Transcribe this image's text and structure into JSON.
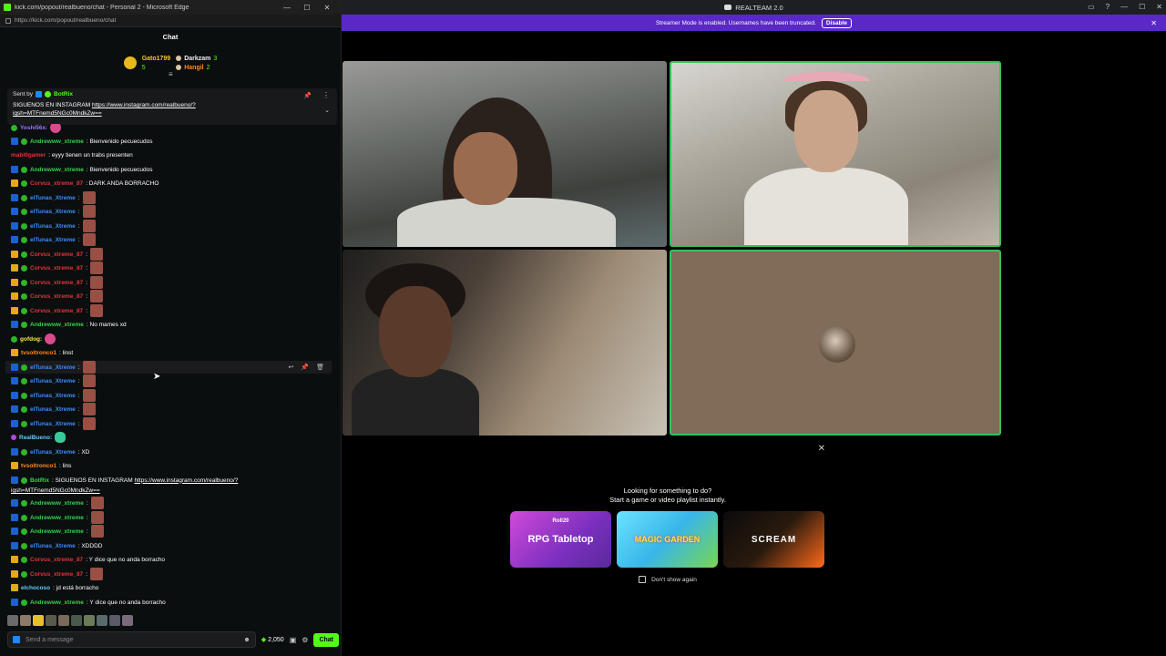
{
  "browser": {
    "title": "kick.com/popout/realbueno/chat - Personal 2 - Microsoft Edge",
    "url": "https://kick.com/popout/realbueno/chat",
    "min": "—",
    "max": "☐",
    "close": "✕"
  },
  "chat": {
    "header": "Chat",
    "leaders": [
      {
        "name": "Gato1799",
        "count": "5"
      },
      {
        "name": "Darkzam",
        "count": "3"
      },
      {
        "name": "Hangil",
        "count": "2"
      }
    ],
    "pinned": {
      "sent_by": "Sent by",
      "bot": "BotRix",
      "text": "SIGUENOS EN INSTAGRAM",
      "link1": "https://www.instagram.com/realbueno/?",
      "link2": "igsh=MTFnemd5NGc0MndkZw=="
    },
    "messages": [
      {
        "user": "Yoshi56x:",
        "text": ""
      },
      {
        "user": "Andrewww_xtreme",
        "text": ": Bienvenido pecuecudos"
      },
      {
        "user": "mabi0gamer",
        "text": ": eyyy tienen un trabs presenten"
      },
      {
        "user": "Andrewww_xtreme",
        "text": ": Bienvenido pecuecudos"
      },
      {
        "user": "Corvus_xtreme_87",
        "text": ": DARK ANDA BORRACHO"
      },
      {
        "user": "elTunas_Xtreme",
        "text": ":"
      },
      {
        "user": "elTunas_Xtreme",
        "text": ":"
      },
      {
        "user": "elTunas_Xtreme",
        "text": ":"
      },
      {
        "user": "elTunas_Xtreme",
        "text": ":"
      },
      {
        "user": "Corvus_xtreme_87",
        "text": ":"
      },
      {
        "user": "Corvus_xtreme_87",
        "text": ":"
      },
      {
        "user": "Corvus_xtreme_87",
        "text": ":"
      },
      {
        "user": "Corvus_xtreme_87",
        "text": ":"
      },
      {
        "user": "Corvus_xtreme_87",
        "text": ":"
      },
      {
        "user": "Andrewww_xtreme",
        "text": ": No mames xd"
      },
      {
        "user": "gofdog:",
        "text": ""
      },
      {
        "user": "tvsoltronco1",
        "text": ": linst"
      },
      {
        "user": "elTunas_Xtreme",
        "text": ":"
      },
      {
        "user": "elTunas_Xtreme",
        "text": ":"
      },
      {
        "user": "elTunas_Xtreme",
        "text": ":"
      },
      {
        "user": "elTunas_Xtreme",
        "text": ":"
      },
      {
        "user": "elTunas_Xtreme",
        "text": ":"
      },
      {
        "user": "RealBueno:",
        "text": ""
      },
      {
        "user": "elTunas_Xtreme",
        "text": ": XD"
      },
      {
        "user": "tvsoltronco1",
        "text": ": lins"
      },
      {
        "user": "BotRix",
        "text": ": SIGUENOS EN INSTAGRAM",
        "link": "https://www.instagram.com/realbueno/?",
        "link2": "igsh=MTFnemd5NGc0MndkZw=="
      },
      {
        "user": "Andrewww_xtreme",
        "text": ":"
      },
      {
        "user": "Andrewww_xtreme",
        "text": ":"
      },
      {
        "user": "Andrewww_xtreme",
        "text": ":"
      },
      {
        "user": "elTunas_Xtreme",
        "text": ": XDDDD"
      },
      {
        "user": "Corvus_xtreme_87",
        "text": ": Y dice que no anda borracho"
      },
      {
        "user": "Corvus_xtreme_87",
        "text": ":"
      },
      {
        "user": "elchocoso",
        "text": ": jd está borracho"
      },
      {
        "user": "Andrewww_xtreme",
        "text": ": Y dice que no anda borracho"
      }
    ],
    "input_placeholder": "Send a message",
    "points": "2,050",
    "send_label": "Chat"
  },
  "discord": {
    "title": "REALTEAM 2.0",
    "banner_text": "Streamer Mode is enabled. Usernames have been truncated.",
    "banner_button": "Disable",
    "activity": {
      "heading1": "Looking for something to do?",
      "heading2": "Start a game or video playlist instantly.",
      "cards": [
        {
          "title": "RPG Tabletop",
          "sub": "Roll20"
        },
        {
          "title": "MAGIC GARDEN",
          "sub": ""
        },
        {
          "title": "SCREAM",
          "sub": ""
        }
      ],
      "dont_show": "Don't show again"
    }
  }
}
